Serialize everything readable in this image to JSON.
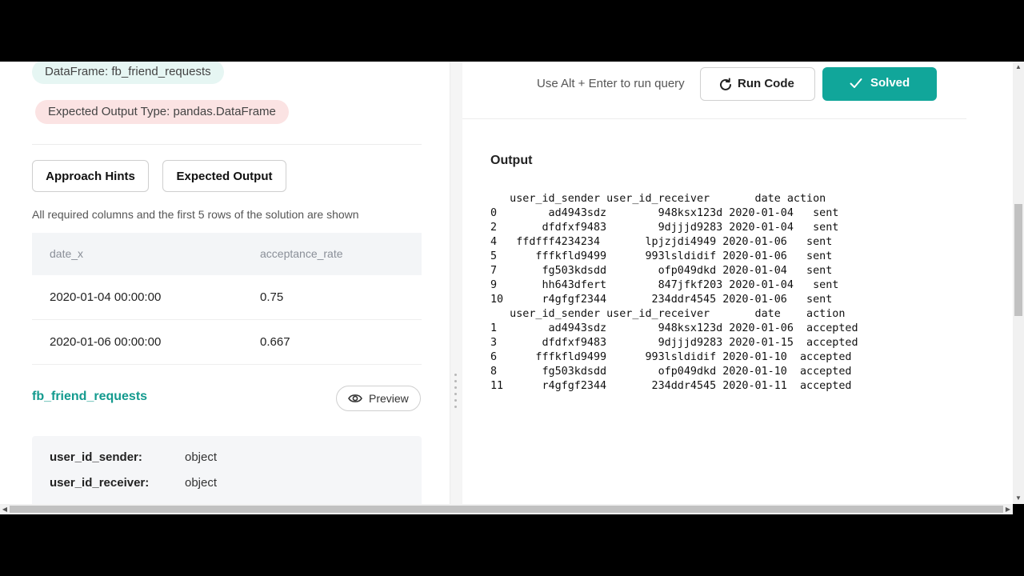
{
  "left": {
    "dataframe_pill": "DataFrame: fb_friend_requests",
    "output_type_pill": "Expected Output Type: pandas.DataFrame",
    "approach_hints_label": "Approach Hints",
    "expected_output_label": "Expected Output",
    "note": "All required columns and the first 5 rows of the solution are shown",
    "result_table": {
      "columns": [
        "date_x",
        "acceptance_rate"
      ],
      "rows": [
        [
          "2020-01-04 00:00:00",
          "0.75"
        ],
        [
          "2020-01-06 00:00:00",
          "0.667"
        ]
      ]
    },
    "table_name": "fb_friend_requests",
    "preview_label": "Preview",
    "schema": [
      {
        "name": "user_id_sender:",
        "type": "object"
      },
      {
        "name": "user_id_receiver:",
        "type": "object"
      }
    ]
  },
  "right": {
    "hint": "Use Alt + Enter to run query",
    "run_label": "Run Code",
    "solved_label": "Solved",
    "accent_color": "#11a69a",
    "output_label": "Output",
    "console_lines": [
      "   user_id_sender user_id_receiver       date action",
      "0        ad4943sdz        948ksx123d 2020-01-04   sent",
      "2       dfdfxf9483        9djjjd9283 2020-01-04   sent",
      "4   ffdfff4234234       lpjzjdi4949 2020-01-06   sent",
      "5      fffkfld9499      993lsldidif 2020-01-06   sent",
      "7       fg503kdsdd        ofp049dkd 2020-01-04   sent",
      "9       hh643dfert        847jfkf203 2020-01-04   sent",
      "10      r4gfgf2344       234ddr4545 2020-01-06   sent",
      "   user_id_sender user_id_receiver       date    action",
      "1        ad4943sdz        948ksx123d 2020-01-06  accepted",
      "3       dfdfxf9483        9djjjd9283 2020-01-15  accepted",
      "6      fffkfld9499      993lsldidif 2020-01-10  accepted",
      "8       fg503kdsdd        ofp049dkd 2020-01-10  accepted",
      "11      r4gfgf2344       234ddr4545 2020-01-11  accepted"
    ]
  }
}
